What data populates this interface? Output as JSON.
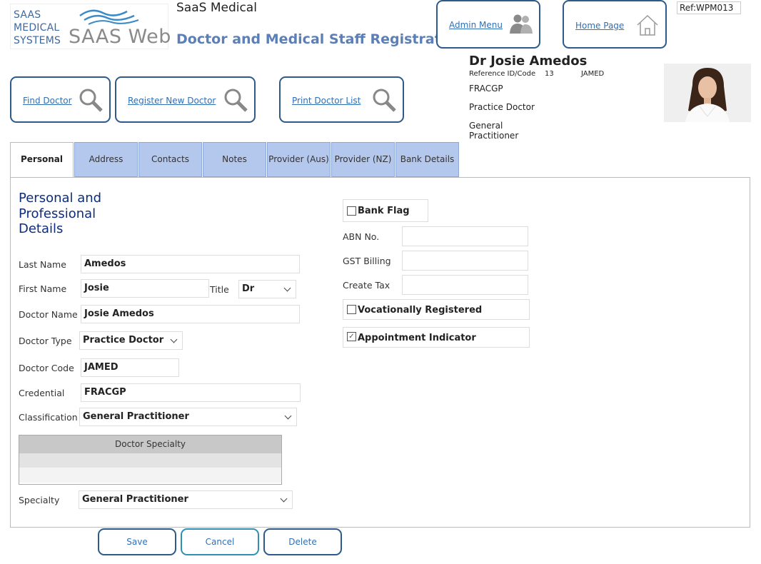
{
  "header": {
    "logo_lines": [
      "SAAS",
      "MEDICAL",
      "SYSTEMS"
    ],
    "logo_product": "SAAS Web",
    "app_name": "SaaS Medical",
    "page_title": "Doctor and Medical Staff Registration",
    "ref_code": "Ref:WPM013",
    "admin_menu": "Admin Menu",
    "home_page": "Home Page"
  },
  "toolbar": {
    "find_doctor": "Find Doctor",
    "register_new": "Register New Doctor",
    "print_list": "Print Doctor List"
  },
  "doctor_summary": {
    "name": "Dr Josie Amedos",
    "ref_label": "Reference ID/Code",
    "ref_id": "13",
    "ref_code": "JAMED",
    "credential": "FRACGP",
    "type": "Practice Doctor",
    "classification_line1": "General",
    "classification_line2": "Practitioner"
  },
  "tabs": [
    "Personal",
    "Address",
    "Contacts",
    "Notes",
    "Provider (Aus)",
    "Provider (NZ)",
    "Bank Details"
  ],
  "active_tab": "Personal",
  "form": {
    "section_title_lines": [
      "Personal and",
      "Professional",
      "Details"
    ],
    "last_name_label": "Last Name",
    "last_name": "Amedos",
    "first_name_label": "First Name",
    "first_name": "Josie",
    "title_label": "Title",
    "title": "Dr",
    "doctor_name_label": "Doctor Name",
    "doctor_name": "Josie Amedos",
    "doctor_type_label": "Doctor Type",
    "doctor_type": "Practice Doctor",
    "doctor_code_label": "Doctor Code",
    "doctor_code": "JAMED",
    "credential_label": "Credential",
    "credential": "FRACGP",
    "classification_label": "Classification",
    "classification": "General Practitioner",
    "specialty_grid_header": "Doctor Specialty",
    "specialty_label": "Specialty",
    "specialty": "General Practitioner"
  },
  "right_form": {
    "bank_flag_label": "Bank Flag",
    "bank_flag": false,
    "abn_label": "ABN No.",
    "abn": "",
    "gst_label": "GST Billing",
    "gst": "",
    "create_tax_label": "Create Tax",
    "create_tax": "",
    "vocational_label": "Vocationally Registered",
    "vocational": false,
    "appointment_label": "Appointment Indicator",
    "appointment": true
  },
  "actions": {
    "save": "Save",
    "cancel": "Cancel",
    "delete": "Delete"
  },
  "colors": {
    "accent": "#5b7fb6",
    "tab_bg": "#b4c7ec",
    "button_border": "#2d5a8a",
    "link": "#2f6fb5",
    "section_title": "#0d2d7a"
  },
  "icons": {
    "admin": "people-icon",
    "home": "house-icon",
    "search": "magnifier-icon"
  }
}
